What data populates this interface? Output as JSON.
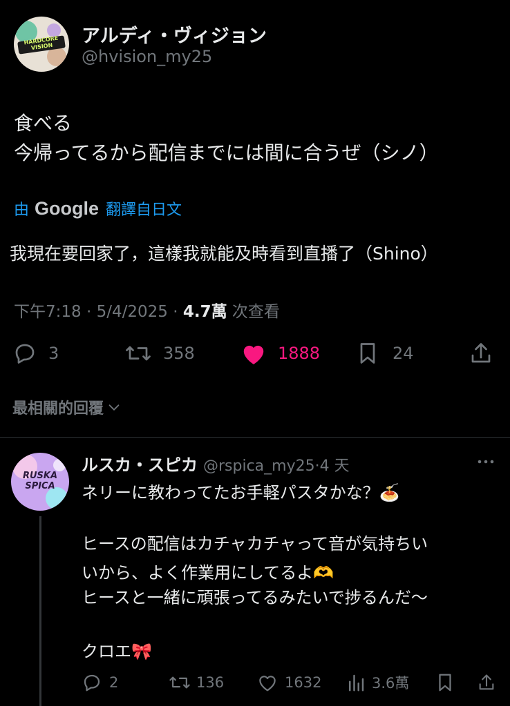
{
  "tweet": {
    "author_name": "アルディ・ヴィジョン",
    "author_handle": "@hvision_my25",
    "avatar_text": "HARDCORE VISION",
    "text_line1": "食べる",
    "text_line2": "今帰ってるから配信までには間に合うぜ（シノ）",
    "translate_prefix": "由",
    "translate_brand": "Google",
    "translate_suffix": "翻譯自日文",
    "translated_text": "我現在要回家了，這樣我就能及時看到直播了（Shino）",
    "time": "下午7:18",
    "date": "5/4/2025",
    "views_count": "4.7萬",
    "views_label": "次查看",
    "replies": "3",
    "retweets": "358",
    "likes": "1888",
    "bookmarks": "24"
  },
  "sort": {
    "label": "最相關的回覆"
  },
  "reply": {
    "author_name": "ルスカ・スピカ",
    "author_handle": "@rspica_my25",
    "time_ago": "4 天",
    "avatar_text": "RUSKA SPICA",
    "line1": "ネリーに教わってたお手軽パスタかな？🍝",
    "line2": "ヒースの配信はカチャカチャって音が気持ちい",
    "line3": "いから、よく作業用にしてるよ🫶",
    "line4": "ヒースと一緒に頑張ってるみたいで捗るんだ〜",
    "line5": "クロエ🎀",
    "replies": "2",
    "retweets": "136",
    "likes": "1632",
    "views": "3.6萬"
  },
  "colors": {
    "background": "#000000",
    "text": "#e7e9ea",
    "muted": "#71767b",
    "link": "#1d9bf0",
    "like": "#f91880",
    "divider": "#2f3336"
  }
}
